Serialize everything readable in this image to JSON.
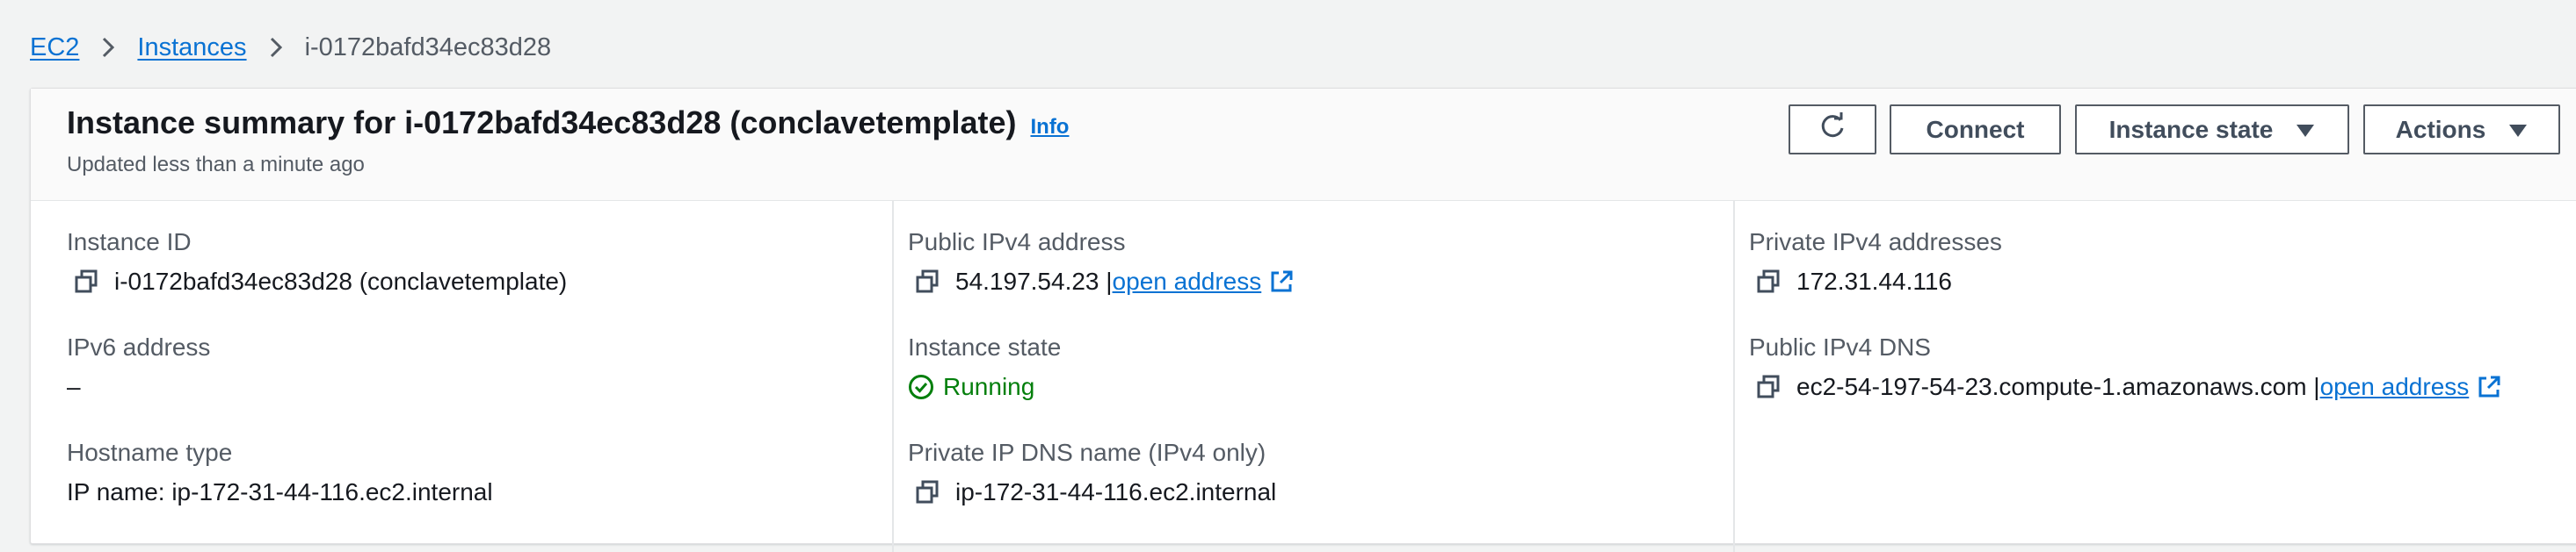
{
  "breadcrumb": {
    "items": [
      {
        "label": "EC2"
      },
      {
        "label": "Instances"
      },
      {
        "label": "i-0172bafd34ec83d28"
      }
    ]
  },
  "header": {
    "title": "Instance summary for i-0172bafd34ec83d28 (conclavetemplate)",
    "info_label": "Info",
    "subtitle": "Updated less than a minute ago"
  },
  "actions": {
    "refresh_icon": "refresh-icon",
    "connect_label": "Connect",
    "instance_state_label": "Instance state",
    "actions_label": "Actions"
  },
  "fields": {
    "instance_id": {
      "label": "Instance ID",
      "value": "i-0172bafd34ec83d28 (conclavetemplate)"
    },
    "ipv6": {
      "label": "IPv6 address",
      "value": "–"
    },
    "hostname_type": {
      "label": "Hostname type",
      "value": "IP name: ip-172-31-44-116.ec2.internal"
    },
    "public_ipv4": {
      "label": "Public IPv4 address",
      "value": "54.197.54.23 |",
      "link": "open address"
    },
    "instance_state": {
      "label": "Instance state",
      "value": "Running",
      "color": "#037f0c"
    },
    "private_ip_dns": {
      "label": "Private IP DNS name (IPv4 only)",
      "value": "ip-172-31-44-116.ec2.internal"
    },
    "private_ipv4": {
      "label": "Private IPv4 addresses",
      "value": "172.31.44.116"
    },
    "public_dns": {
      "label": "Public IPv4 DNS",
      "value": "ec2-54-197-54-23.compute-1.amazonaws.com |",
      "link": "open address"
    }
  },
  "colors": {
    "link": "#0972d3",
    "running": "#037f0c",
    "text": "#16191f",
    "secondary_text": "#545b64"
  }
}
